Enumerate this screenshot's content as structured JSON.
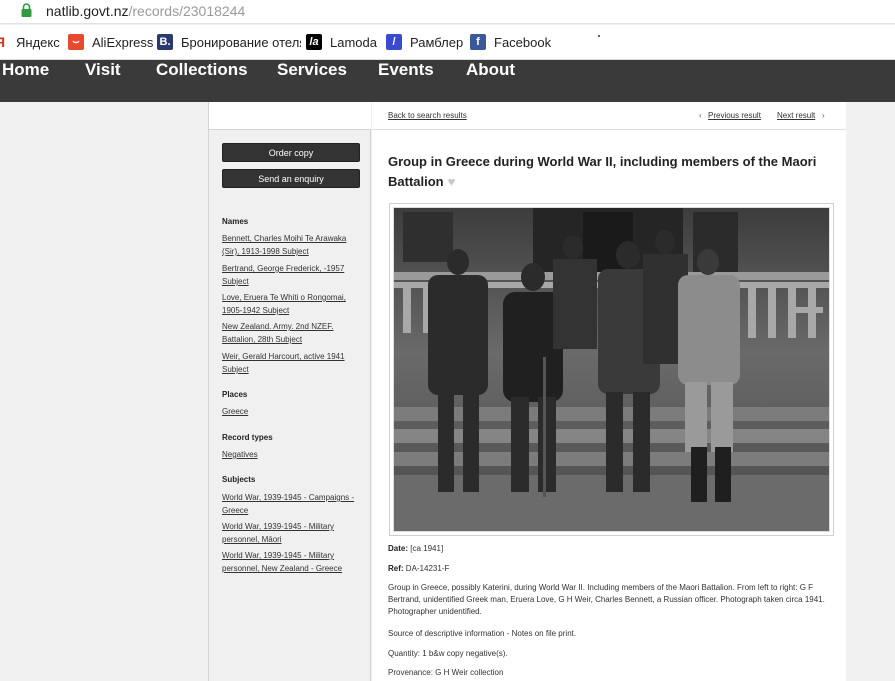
{
  "browser": {
    "url_host": "natlib.govt.nz",
    "url_path": "/records/23018244"
  },
  "bookmarks": [
    {
      "label": "Яндекс",
      "icon": "yandex-icon",
      "color": "#e0321e"
    },
    {
      "label": "AliExpress",
      "icon": "aliexpress-icon",
      "color": "#e8482c"
    },
    {
      "label": "Бронирование отеля",
      "icon": "booking-icon",
      "color": "#2b3a6e"
    },
    {
      "label": "Lamoda",
      "icon": "lamoda-icon",
      "color": "#000000"
    },
    {
      "label": "Рамблер",
      "icon": "rambler-icon",
      "color": "#3b4bd1"
    },
    {
      "label": "Facebook",
      "icon": "facebook-icon",
      "color": "#3b5998"
    }
  ],
  "nav": [
    "Home",
    "Visit",
    "Collections",
    "Services",
    "Events",
    "About"
  ],
  "sidebar": {
    "order_copy": "Order copy",
    "send_enquiry": "Send an enquiry",
    "names_heading": "Names",
    "names": [
      "Bennett, Charles Moihi Te Arawaka (Sir), 1913-1998 Subject",
      "Bertrand, George Frederick, -1957 Subject",
      "Love, Eruera Te Whiti o Rongomai, 1905-1942 Subject",
      "New Zealand. Army. 2nd NZEF. Battalion, 28th Subject",
      "Weir, Gerald Harcourt, active 1941 Subject"
    ],
    "places_heading": "Places",
    "places": [
      "Greece"
    ],
    "record_types_heading": "Record types",
    "record_types": [
      "Negatives"
    ],
    "subjects_heading": "Subjects",
    "subjects": [
      "World War, 1939-1945 - Campaigns - Greece",
      "World War, 1939-1945 - Military personnel, Māori",
      "World War, 1939-1945 - Military personnel, New Zealand - Greece"
    ]
  },
  "record": {
    "back": "Back to search results",
    "previous": "Previous result",
    "next": "Next result",
    "title": "Group in Greece during World War II, including members of the Maori Battalion",
    "date_label": "Date:",
    "date_value": "[ca 1941]",
    "ref_label": "Ref:",
    "ref_value": "DA-14231-F",
    "description": "Group in Greece, possibly Katerini, during World War II. Including members of the Maori Battalion. From left to right: G F Bertrand, unidentified Greek man, Eruera Love, G H Weir, Charles Bennett, a Russian officer. Photograph taken circa 1941. Photographer unidentified.",
    "source": "Source of descriptive information - Notes on file print.",
    "quantity": "Quantity: 1 b&w copy negative(s).",
    "provenance": "Provenance: G H Weir collection"
  },
  "colors": {
    "nav_bg": "#3a3a3a",
    "button_bg": "#333333",
    "lock_green": "#2e9d3f"
  }
}
